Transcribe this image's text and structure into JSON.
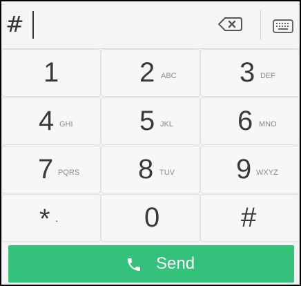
{
  "input": {
    "value": "#"
  },
  "keys": [
    {
      "digit": "1",
      "letters": ""
    },
    {
      "digit": "2",
      "letters": "ABC"
    },
    {
      "digit": "3",
      "letters": "DEF"
    },
    {
      "digit": "4",
      "letters": "GHI"
    },
    {
      "digit": "5",
      "letters": "JKL"
    },
    {
      "digit": "6",
      "letters": "MNO"
    },
    {
      "digit": "7",
      "letters": "PQRS"
    },
    {
      "digit": "8",
      "letters": "TUV"
    },
    {
      "digit": "9",
      "letters": "WXYZ"
    },
    {
      "digit": "*",
      "letters": "."
    },
    {
      "digit": "0",
      "letters": ""
    },
    {
      "digit": "#",
      "letters": ""
    }
  ],
  "send": {
    "label": "Send",
    "icon": "phone-icon",
    "color": "#34c27b"
  },
  "icons": {
    "backspace": "backspace-icon",
    "keyboard": "keyboard-icon"
  }
}
